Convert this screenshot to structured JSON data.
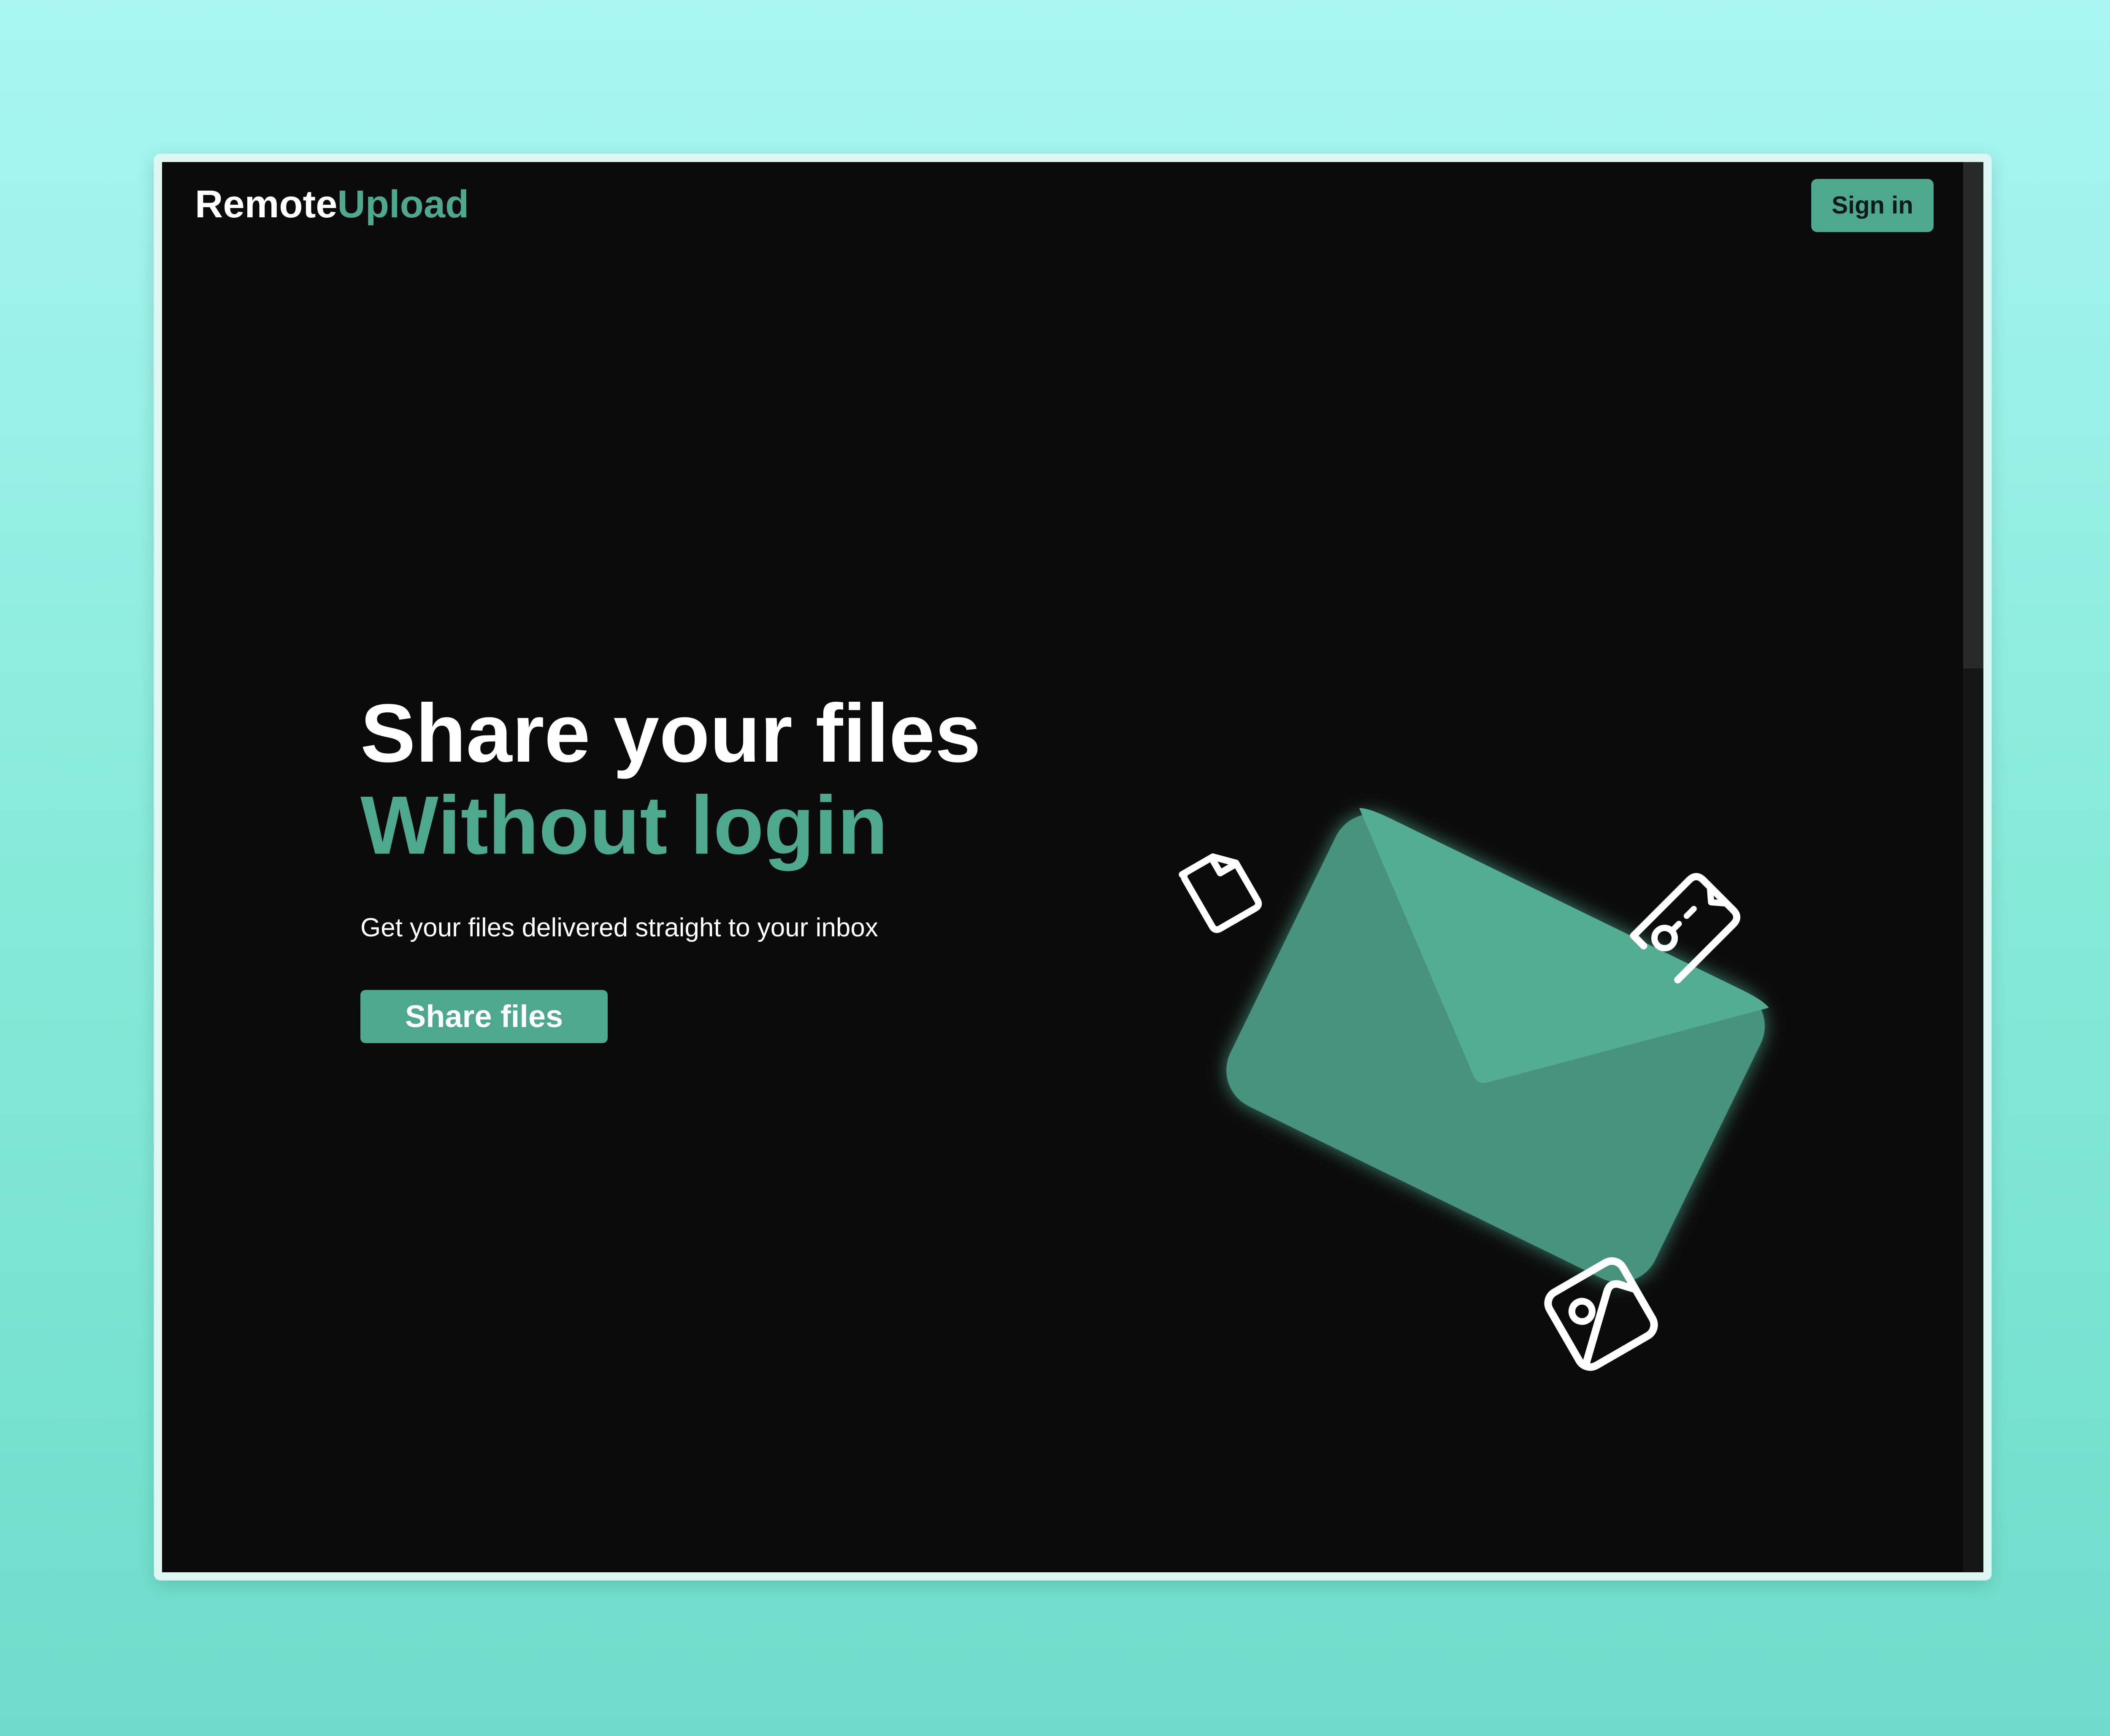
{
  "header": {
    "logo_part1": "Remote",
    "logo_part2": "Upload",
    "signin_label": "Sign in"
  },
  "hero": {
    "title_line1": "Share your files",
    "title_line2": "Without login",
    "subtitle": "Get your files delivered straight to your inbox",
    "cta_label": "Share files"
  },
  "colors": {
    "accent": "#4ea88d",
    "background": "#0b0b0b",
    "text": "#ffffff"
  },
  "icons": [
    "envelope-icon",
    "file-icon",
    "key-icon",
    "image-icon"
  ]
}
